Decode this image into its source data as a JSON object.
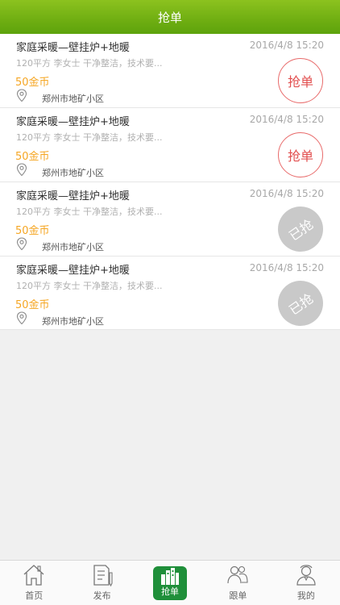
{
  "header": {
    "title": "抢单"
  },
  "orders": [
    {
      "title": "家庭采暖—壁挂炉+地暖",
      "date": "2016/4/8 15:20",
      "desc": "120平方 李女士 干净整洁，技术要...",
      "price": "50金币",
      "address": "郑州市地矿小区",
      "action": "抢单",
      "grabbed": false
    },
    {
      "title": "家庭采暖—壁挂炉+地暖",
      "date": "2016/4/8 15:20",
      "desc": "120平方 李女士 干净整洁，技术要...",
      "price": "50金币",
      "address": "郑州市地矿小区",
      "action": "抢单",
      "grabbed": false
    },
    {
      "title": "家庭采暖—壁挂炉+地暖",
      "date": "2016/4/8 15:20",
      "desc": "120平方 李女士 干净整洁，技术要...",
      "price": "50金币",
      "address": "郑州市地矿小区",
      "action": "已抢",
      "grabbed": true
    },
    {
      "title": "家庭采暖—壁挂炉+地暖",
      "date": "2016/4/8 15:20",
      "desc": "120平方 李女士 干净整洁，技术要...",
      "price": "50金币",
      "address": "郑州市地矿小区",
      "action": "已抢",
      "grabbed": true
    }
  ],
  "tabbar": {
    "items": [
      {
        "label": "首页",
        "icon": "home-icon"
      },
      {
        "label": "发布",
        "icon": "publish-icon"
      },
      {
        "label": "抢单",
        "icon": "grab-order-icon",
        "active": true
      },
      {
        "label": "跟单",
        "icon": "follow-order-icon"
      },
      {
        "label": "我的",
        "icon": "profile-icon"
      }
    ]
  },
  "colors": {
    "header_green": "#6fae12",
    "active_tab": "#1f8f3a",
    "price": "#f5a623",
    "grab_red": "#e24f4f",
    "grabbed_gray": "#c9c9c9"
  }
}
